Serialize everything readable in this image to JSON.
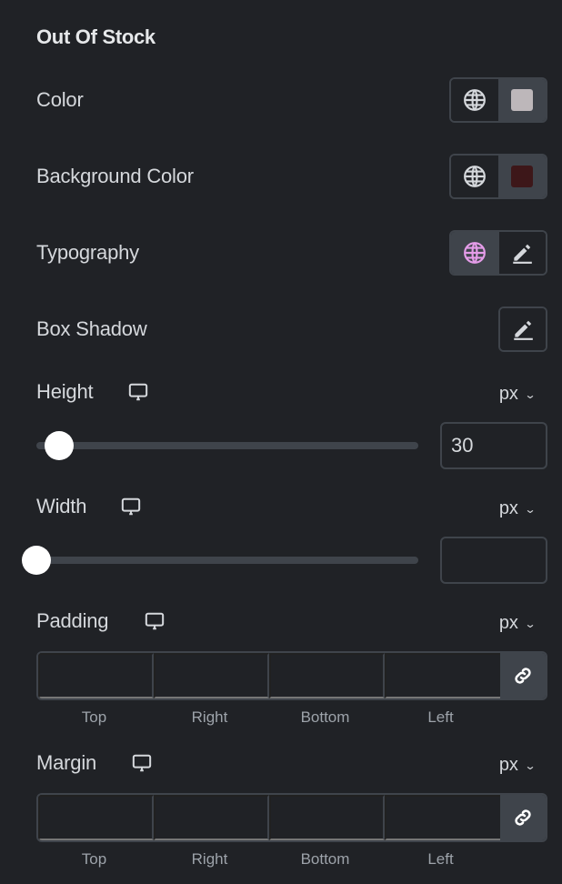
{
  "section": {
    "title": "Out Of Stock"
  },
  "color": {
    "label": "Color",
    "global_icon": "globe-icon",
    "swatch": "#bdb7ba"
  },
  "background_color": {
    "label": "Background Color",
    "global_icon": "globe-icon",
    "swatch": "#3d1719"
  },
  "typography": {
    "label": "Typography",
    "global_icon": "globe-icon",
    "global_active_color": "#e49ce8",
    "edit_icon": "pencil-icon"
  },
  "box_shadow": {
    "label": "Box Shadow",
    "edit_icon": "pencil-icon"
  },
  "height": {
    "label": "Height",
    "device_icon": "desktop-icon",
    "unit": "px",
    "value": "30",
    "slider_fraction": 0.06
  },
  "width": {
    "label": "Width",
    "device_icon": "desktop-icon",
    "unit": "px",
    "value": "",
    "slider_fraction": 0
  },
  "padding": {
    "label": "Padding",
    "device_icon": "desktop-icon",
    "unit": "px",
    "fields": [
      {
        "label": "Top",
        "value": ""
      },
      {
        "label": "Right",
        "value": ""
      },
      {
        "label": "Bottom",
        "value": ""
      },
      {
        "label": "Left",
        "value": ""
      }
    ],
    "link_icon": "link-icon"
  },
  "margin": {
    "label": "Margin",
    "device_icon": "desktop-icon",
    "unit": "px",
    "fields": [
      {
        "label": "Top",
        "value": ""
      },
      {
        "label": "Right",
        "value": ""
      },
      {
        "label": "Bottom",
        "value": ""
      },
      {
        "label": "Left",
        "value": ""
      }
    ],
    "link_icon": "link-icon"
  }
}
